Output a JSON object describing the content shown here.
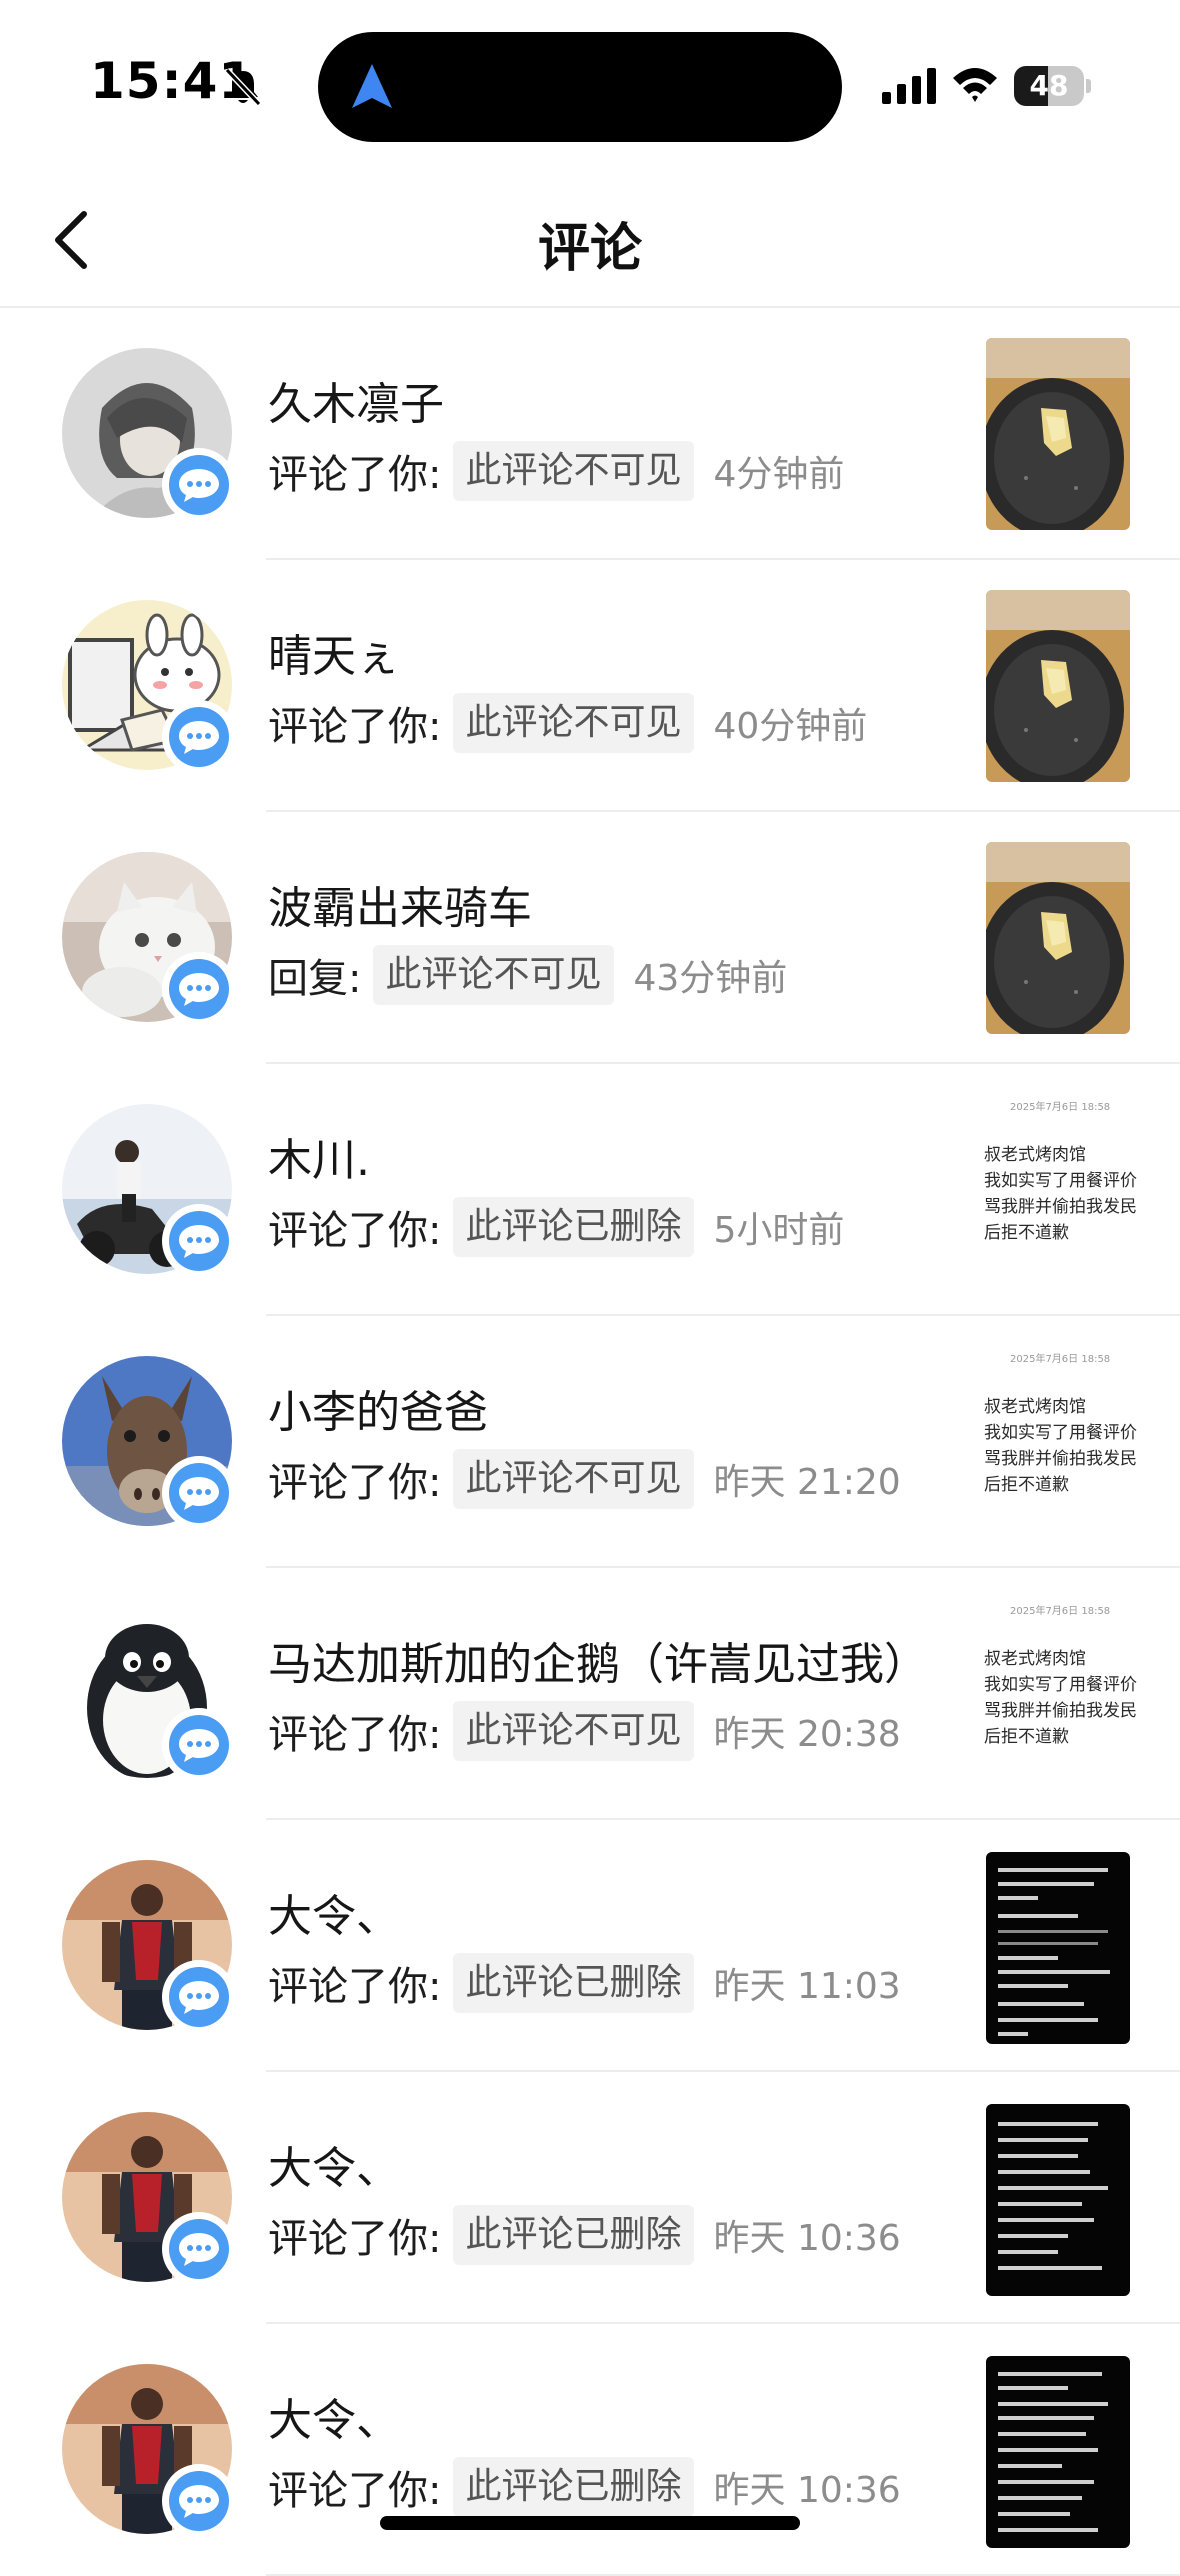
{
  "status_bar": {
    "time": "15:41",
    "battery_level": "48",
    "battery_fraction": 0.48,
    "icons": [
      "bell-muted-icon",
      "navigation-arrow-icon",
      "cellular-signal-icon",
      "wifi-icon",
      "battery-icon"
    ]
  },
  "header": {
    "title": "评论",
    "back_icon": "chevron-left-icon"
  },
  "notifications": [
    {
      "username": "久木凛子",
      "action": "评论了你:",
      "status": "此评论不可见",
      "time": "4分钟前",
      "avatar": "avatar-sketch-portrait",
      "thumbnail": {
        "kind": "photo",
        "subject": "plate-of-food"
      }
    },
    {
      "username": "晴天ぇ",
      "action": "评论了你:",
      "status": "此评论不可见",
      "time": "40分钟前",
      "avatar": "avatar-cartoon-bunny",
      "thumbnail": {
        "kind": "photo",
        "subject": "plate-of-food"
      }
    },
    {
      "username": "波霸出来骑车",
      "action": "回复:",
      "status": "此评论不可见",
      "time": "43分钟前",
      "avatar": "avatar-white-cat",
      "thumbnail": {
        "kind": "photo",
        "subject": "plate-of-food"
      }
    },
    {
      "username": "木川.",
      "action": "评论了你:",
      "status": "此评论已删除",
      "time": "5小时前",
      "avatar": "avatar-motorcycle-rider",
      "thumbnail": {
        "kind": "text",
        "date": "2025年7月6日 18:58",
        "lines": [
          "叔老式烤肉馆",
          "我如实写了用餐评价",
          "骂我胖并偷拍我发民",
          "后拒不道歉"
        ]
      }
    },
    {
      "username": "小李的爸爸",
      "action": "评论了你:",
      "status": "此评论不可见",
      "time": "昨天 21:20",
      "avatar": "avatar-donkey",
      "thumbnail": {
        "kind": "text",
        "date": "2025年7月6日 18:58",
        "lines": [
          "叔老式烤肉馆",
          "我如实写了用餐评价",
          "骂我胖并偷拍我发民",
          "后拒不道歉"
        ]
      }
    },
    {
      "username": "马达加斯加的企鹅（许嵩见过我）",
      "action": "评论了你:",
      "status": "此评论不可见",
      "time": "昨天 20:38",
      "avatar": "avatar-penguin",
      "thumbnail": {
        "kind": "text",
        "date": "2025年7月6日 18:58",
        "lines": [
          "叔老式烤肉馆",
          "我如实写了用餐评价",
          "骂我胖并偷拍我发民",
          "后拒不道歉"
        ]
      }
    },
    {
      "username": "大令、",
      "action": "评论了你:",
      "status": "此评论已删除",
      "time": "昨天 11:03",
      "avatar": "avatar-basketball-player",
      "thumbnail": {
        "kind": "dark-text"
      }
    },
    {
      "username": "大令、",
      "action": "评论了你:",
      "status": "此评论已删除",
      "time": "昨天 10:36",
      "avatar": "avatar-basketball-player",
      "thumbnail": {
        "kind": "dark-text"
      }
    },
    {
      "username": "大令、",
      "action": "评论了你:",
      "status": "此评论已删除",
      "time": "昨天 10:36",
      "avatar": "avatar-basketball-player",
      "thumbnail": {
        "kind": "dark-text"
      }
    }
  ],
  "colors": {
    "badge_blue": "#4a9df3",
    "chip_bg": "#f2f2f2",
    "divider": "#ededed",
    "secondary_text": "#8c8c8c"
  }
}
